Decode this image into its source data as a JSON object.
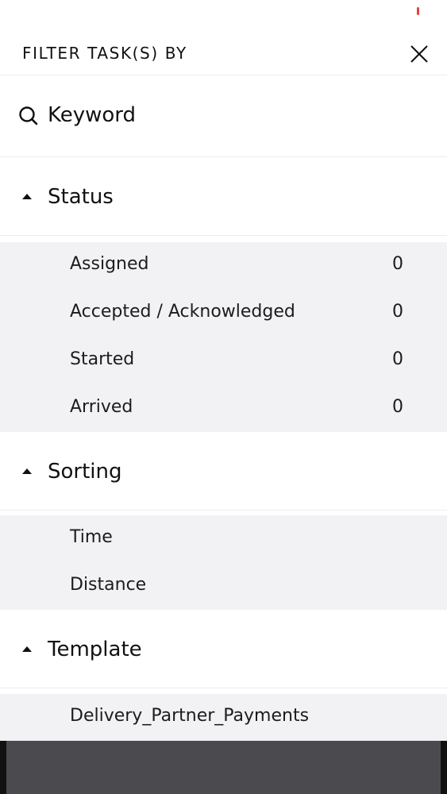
{
  "header": {
    "title": "FILTER TASK(S) BY",
    "close_icon": "close-icon"
  },
  "keyword": {
    "icon": "search-icon",
    "label": "Keyword"
  },
  "status": {
    "title": "Status",
    "items": [
      {
        "label": "Assigned",
        "count": "0"
      },
      {
        "label": "Accepted / Acknowledged",
        "count": "0"
      },
      {
        "label": "Started",
        "count": "0"
      },
      {
        "label": "Arrived",
        "count": "0"
      }
    ]
  },
  "sorting": {
    "title": "Sorting",
    "items": [
      {
        "label": "Time"
      },
      {
        "label": "Distance"
      }
    ]
  },
  "template": {
    "title": "Template",
    "items": [
      {
        "label": "Delivery_Partner_Payments"
      }
    ]
  },
  "colors": {
    "panel_bg": "#f2f2f5",
    "status_dot": "#e0443e",
    "bottom_bar": "#4b4a4e"
  }
}
